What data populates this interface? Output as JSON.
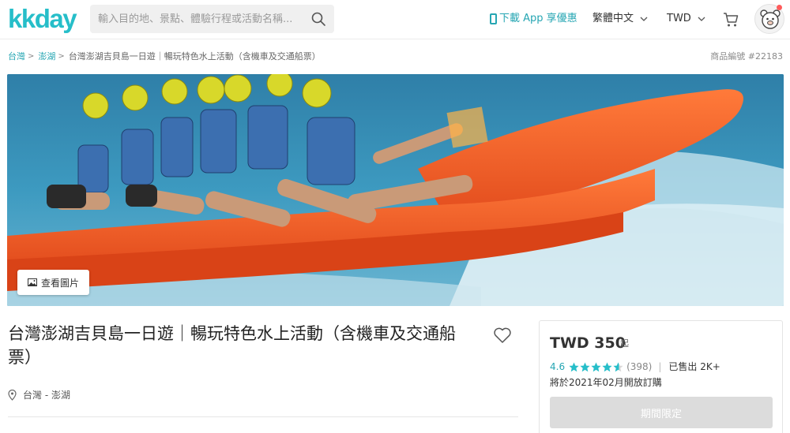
{
  "header": {
    "logo": "kkday",
    "search": {
      "placeholder": "輸入目的地、景點、體驗行程或活動名稱..."
    },
    "app_link": "下載 App 享優惠",
    "language": "繁體中文",
    "currency": "TWD"
  },
  "breadcrumb": {
    "items": [
      "台灣",
      "澎湖"
    ],
    "current": "台灣澎湖吉貝島一日遊｜暢玩特色水上活動（含機車及交通船票）"
  },
  "product_code": "商品編號 #22183",
  "hero": {
    "view_photos_label": "查看圖片"
  },
  "product": {
    "title": "台灣澎湖吉貝島一日遊｜暢玩特色水上活動（含機車及交通船票）",
    "location": "台灣 - 澎湖"
  },
  "price_card": {
    "price": "TWD 350",
    "price_suffix": "起",
    "rating": "4.6",
    "rating_stars": 4.6,
    "review_count": "(398)",
    "sold": "已售出 2K+",
    "open_date": "將於2021年02月開放訂購",
    "button_label": "期間限定"
  },
  "colors": {
    "brand": "#26bec9",
    "link": "#26a6b3",
    "star": "#26bec9",
    "button_disabled": "#dcdcdc"
  }
}
